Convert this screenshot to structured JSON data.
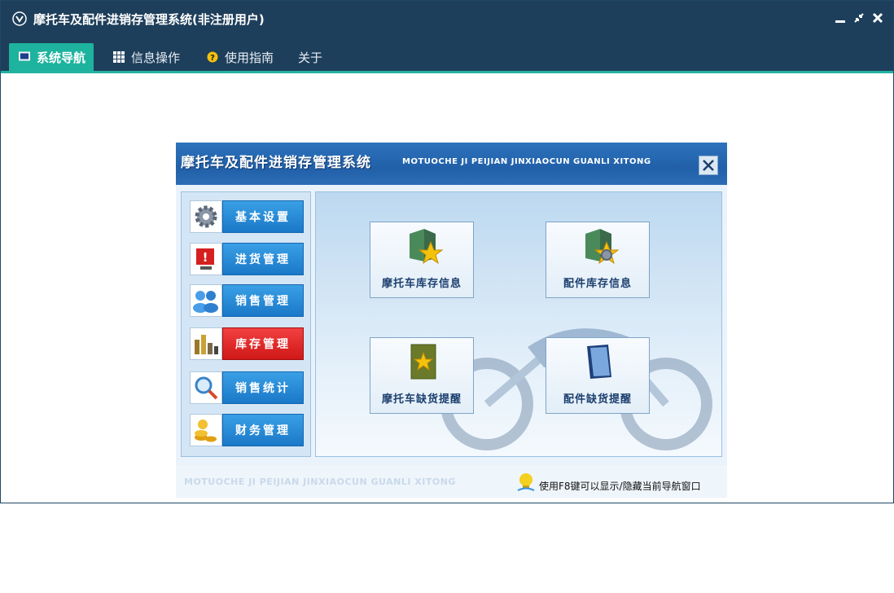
{
  "window": {
    "title": "摩托车及配件进销存管理系统(非注册用户)"
  },
  "tabs": [
    {
      "label": "系统导航",
      "icon": "monitor-icon"
    },
    {
      "label": "信息操作",
      "icon": "grid-icon"
    },
    {
      "label": "使用指南",
      "icon": "help-icon"
    },
    {
      "label": "关于",
      "icon": ""
    }
  ],
  "nav": {
    "title": "摩托车及配件进销存管理系统",
    "subtitle": "MOTUOCHE JI PEIJIAN JINXIAOCUN GUANLI XITONG",
    "menu": [
      {
        "label": "基本设置",
        "icon": "gear-icon"
      },
      {
        "label": "进货管理",
        "icon": "alert-monitor-icon"
      },
      {
        "label": "销售管理",
        "icon": "users-icon"
      },
      {
        "label": "库存管理",
        "icon": "warehouse-icon",
        "active": true
      },
      {
        "label": "销售统计",
        "icon": "magnifier-icon"
      },
      {
        "label": "财务管理",
        "icon": "coins-icon"
      }
    ],
    "cards": [
      {
        "label": "摩托车库存信息",
        "icon": "box-star-icon"
      },
      {
        "label": "配件库存信息",
        "icon": "box-gear-icon"
      },
      {
        "label": "摩托车缺货提醒",
        "icon": "folder-star-icon"
      },
      {
        "label": "配件缺货提醒",
        "icon": "book-icon"
      }
    ],
    "footer_text": "MOTUOCHE JI PEIJIAN JINXIAOCUN GUANLI XITONG",
    "hint": "使用F8键可以显示/隐藏当前导航窗口"
  },
  "colors": {
    "titlebar": "#1e3f5b",
    "accent": "#1eb39e",
    "menu_blue": "#1a78c8",
    "menu_active": "#d01818"
  }
}
